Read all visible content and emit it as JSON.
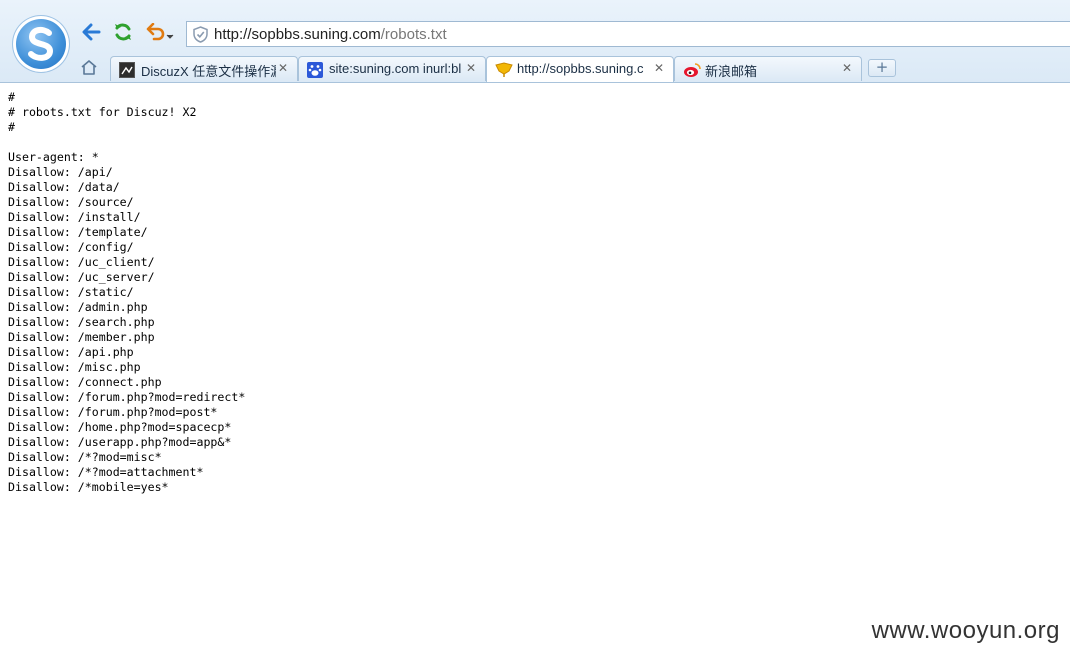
{
  "address_bar": {
    "url_host": "http://sopbbs.suning.com",
    "url_path": "/robots.txt"
  },
  "tabs": [
    {
      "title": "DiscuzX 任意文件操作漏",
      "icon": "discuz-favicon-icon",
      "active": false
    },
    {
      "title": "site:suning.com inurl:bl",
      "icon": "baidu-paw-icon",
      "active": false
    },
    {
      "title": "http://sopbbs.suning.c",
      "icon": "suning-favicon-icon",
      "active": true
    },
    {
      "title": "新浪邮箱",
      "icon": "weibo-icon",
      "active": false
    }
  ],
  "new_tab_label": "+",
  "close_glyph": "✕",
  "page_lines": [
    "#",
    "# robots.txt for Discuz! X2",
    "#",
    "",
    "User-agent: *",
    "Disallow: /api/",
    "Disallow: /data/",
    "Disallow: /source/",
    "Disallow: /install/",
    "Disallow: /template/",
    "Disallow: /config/",
    "Disallow: /uc_client/",
    "Disallow: /uc_server/",
    "Disallow: /static/",
    "Disallow: /admin.php",
    "Disallow: /search.php",
    "Disallow: /member.php",
    "Disallow: /api.php",
    "Disallow: /misc.php",
    "Disallow: /connect.php",
    "Disallow: /forum.php?mod=redirect*",
    "Disallow: /forum.php?mod=post*",
    "Disallow: /home.php?mod=spacecp*",
    "Disallow: /userapp.php?mod=app&*",
    "Disallow: /*?mod=misc*",
    "Disallow: /*?mod=attachment*",
    "Disallow: /*mobile=yes*"
  ],
  "watermark": "www.wooyun.org",
  "colors": {
    "chrome_bg": "#dbe9f6",
    "back_arrow": "#2a7ad6",
    "refresh": "#2fa12f",
    "undo": "#e07b12"
  }
}
